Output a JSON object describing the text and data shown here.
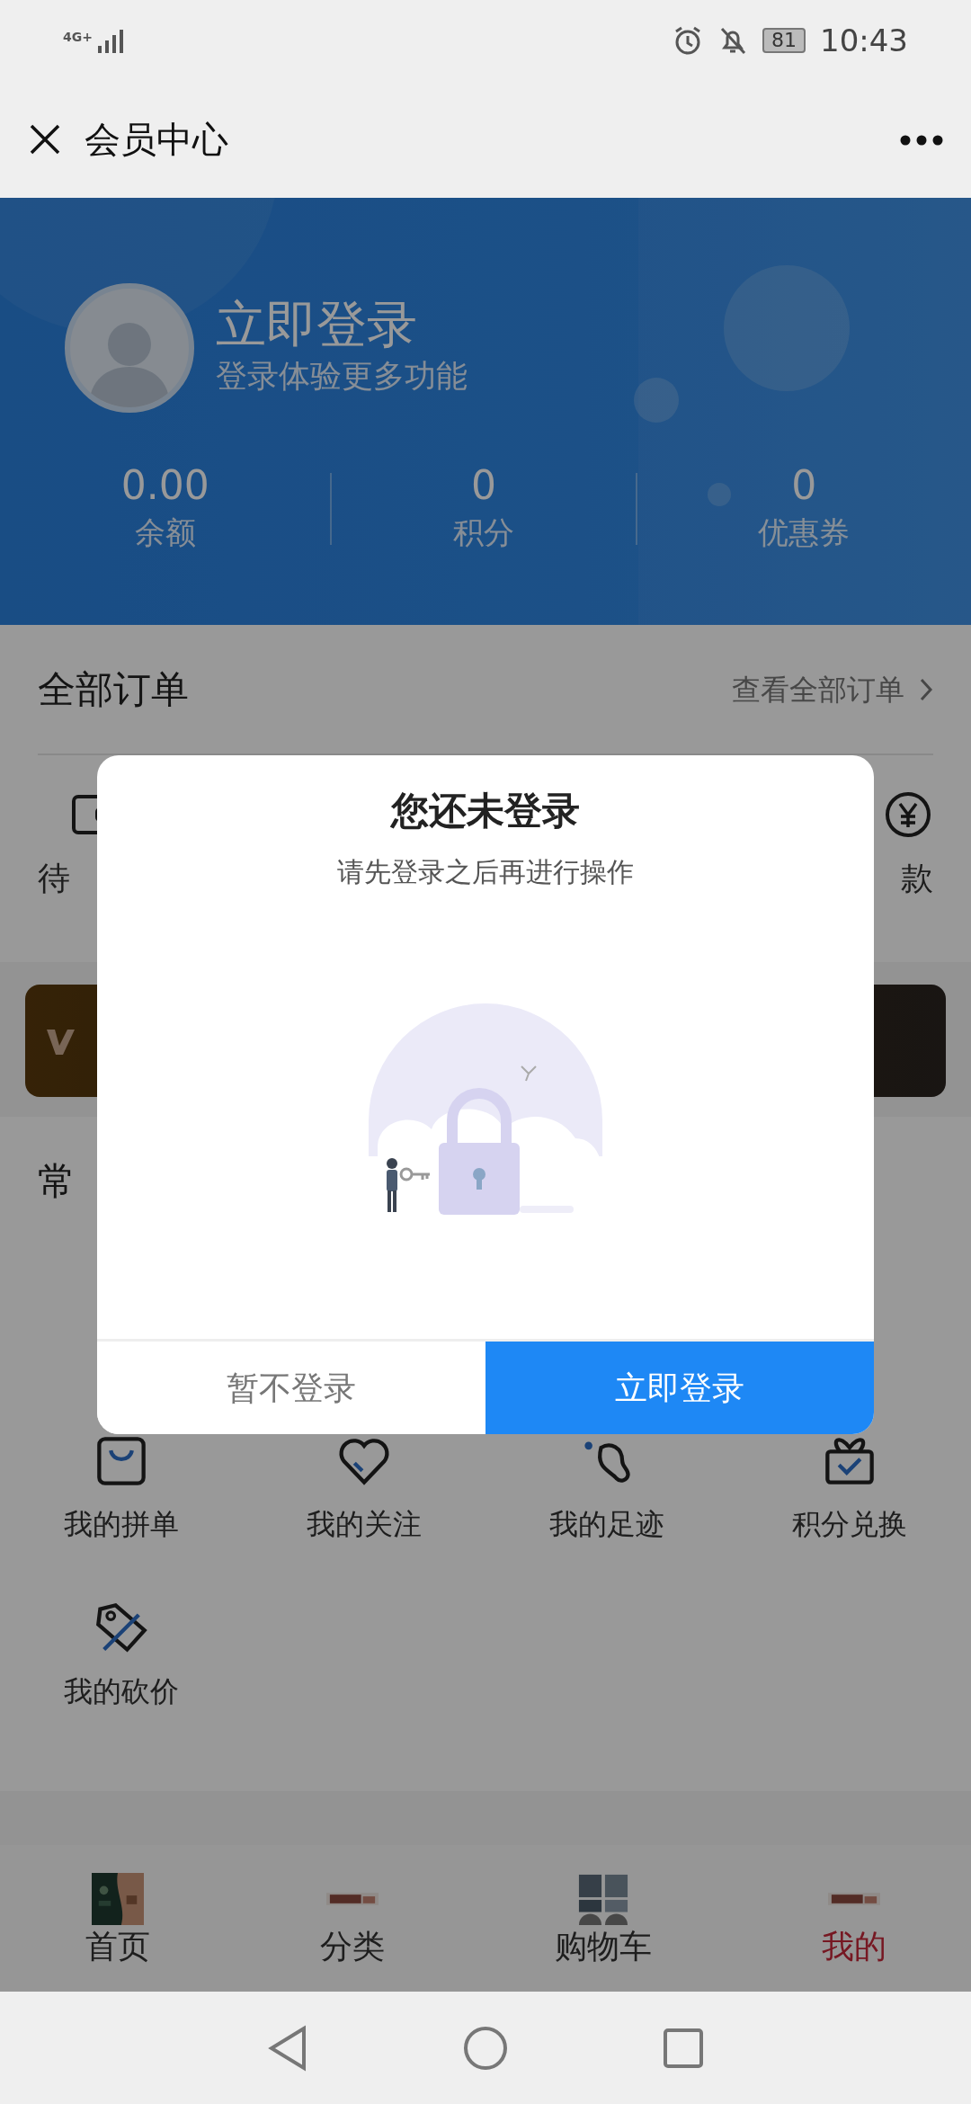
{
  "status_bar": {
    "network": "4G+",
    "battery": "81",
    "time": "10:43"
  },
  "header": {
    "title": "会员中心"
  },
  "profile": {
    "login": "立即登录",
    "subtitle": "登录体验更多功能"
  },
  "stats": [
    {
      "value": "0.00",
      "label": "余额"
    },
    {
      "value": "0",
      "label": "积分"
    },
    {
      "value": "0",
      "label": "优惠券"
    }
  ],
  "orders": {
    "title": "全部订单",
    "link": "查看全部订单",
    "items": [
      {
        "kind": "wallet",
        "label": "待"
      },
      {
        "kind": "refund",
        "label": "款"
      }
    ]
  },
  "tools": {
    "title": "常",
    "items": [
      {
        "kind": "bag",
        "label": "我的拼单"
      },
      {
        "kind": "heart",
        "label": "我的关注"
      },
      {
        "kind": "foot",
        "label": "我的足迹"
      },
      {
        "kind": "gift",
        "label": "积分兑换"
      },
      {
        "kind": "tag",
        "label": "我的砍价"
      }
    ]
  },
  "tab_bar": [
    {
      "label": "首页",
      "selected": false
    },
    {
      "label": "分类",
      "selected": false
    },
    {
      "label": "购物车",
      "selected": false
    },
    {
      "label": "我的",
      "selected": true
    }
  ],
  "modal": {
    "title": "您还未登录",
    "message": "请先登录之后再进行操作",
    "buttons": [
      {
        "kind": "secondary",
        "label": "暂不登录"
      },
      {
        "kind": "primary",
        "label": "立即登录"
      }
    ]
  }
}
